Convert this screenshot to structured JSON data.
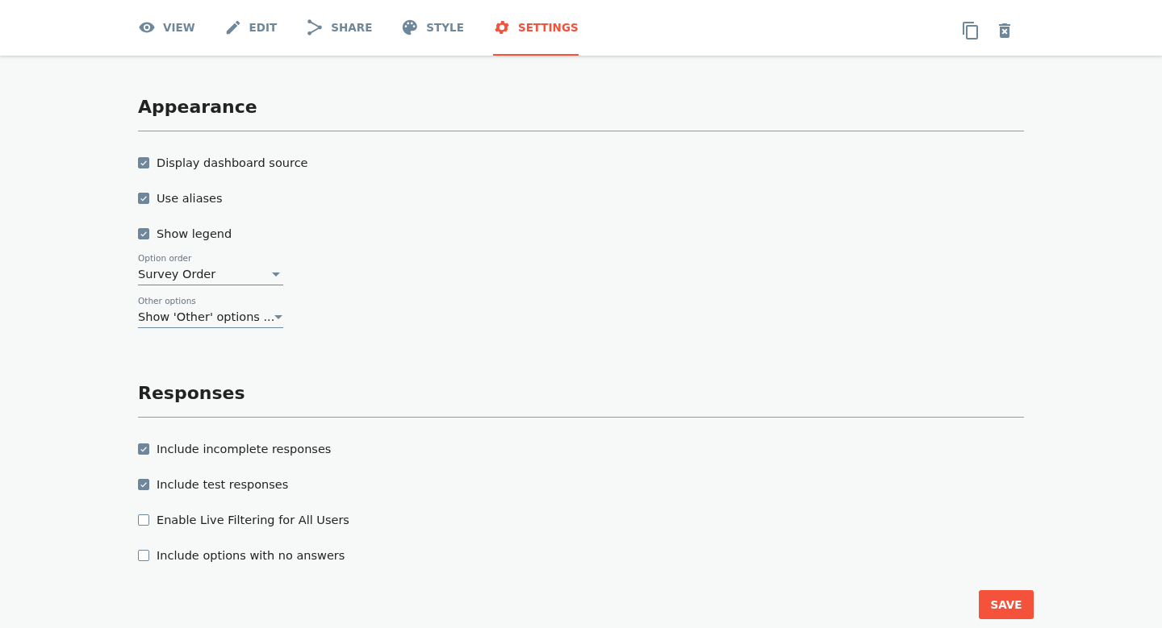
{
  "tabs": [
    {
      "label": "VIEW",
      "selected": false
    },
    {
      "label": "EDIT",
      "selected": false
    },
    {
      "label": "SHARE",
      "selected": false
    },
    {
      "label": "STYLE",
      "selected": false
    },
    {
      "label": "SETTINGS",
      "selected": true
    }
  ],
  "sections": [
    {
      "title": "Appearance",
      "items": [
        {
          "kind": "checkbox",
          "label": "Display dashboard source",
          "checked": true
        },
        {
          "kind": "checkbox",
          "label": "Use aliases",
          "checked": true
        },
        {
          "kind": "checkbox",
          "label": "Show legend",
          "checked": true
        },
        {
          "kind": "select",
          "label": "Option order",
          "value": "Survey Order"
        },
        {
          "kind": "select",
          "label": "Other options",
          "value": "Show 'Other' options ..."
        }
      ]
    },
    {
      "title": "Responses",
      "items": [
        {
          "kind": "checkbox",
          "label": "Include incomplete responses",
          "checked": true
        },
        {
          "kind": "checkbox",
          "label": "Include test responses",
          "checked": true
        },
        {
          "kind": "checkbox",
          "label": "Enable Live Filtering for All Users",
          "checked": false
        },
        {
          "kind": "checkbox",
          "label": "Include options with no answers",
          "checked": false
        }
      ]
    }
  ],
  "save_button": "SAVE"
}
